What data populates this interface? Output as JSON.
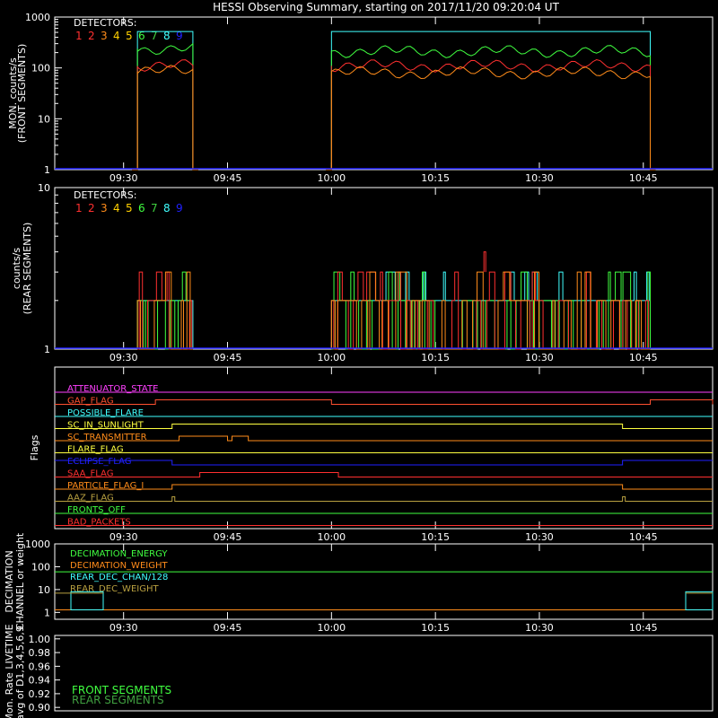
{
  "title": "HESSI Observing Summary, starting on 2017/11/20 09:20:04 UT",
  "colors": {
    "background": "#000000",
    "axes": "#ffffff",
    "det1": "#ff3030",
    "det2": "#ff3030",
    "det3": "#ff8c1a",
    "det4": "#ffd000",
    "det5": "#ffd000",
    "det6": "#40ff40",
    "det7": "#40d040",
    "det8": "#40ffff",
    "det9": "#2020ff"
  },
  "time_ticks": [
    "09:30",
    "09:45",
    "10:00",
    "10:15",
    "10:30",
    "10:45"
  ],
  "panel1": {
    "ylabel": "MON. counts/s",
    "ylabel2": "(FRONT SEGMENTS)",
    "legend_title": "DETECTORS:",
    "yticks": [
      "1",
      "10",
      "100",
      "1000"
    ],
    "detector_numbers": [
      "1",
      "2",
      "3",
      "4",
      "5",
      "6",
      "7",
      "8",
      "9"
    ]
  },
  "panel2": {
    "ylabel": "counts/s",
    "ylabel2": "(REAR SEGMENTS)",
    "legend_title": "DETECTORS:",
    "yticks": [
      "1",
      "10"
    ],
    "detector_numbers": [
      "1",
      "2",
      "3",
      "4",
      "5",
      "6",
      "7",
      "8",
      "9"
    ]
  },
  "panel3": {
    "ylabel": "Flags",
    "flags": [
      {
        "label": "ATTENUATOR_STATE",
        "color": "#ff40ff"
      },
      {
        "label": "GAP_FLAG",
        "color": "#ff5030"
      },
      {
        "label": "POSSIBLE_FLARE",
        "color": "#40ffff"
      },
      {
        "label": "SC_IN_SUNLIGHT",
        "color": "#ffff40"
      },
      {
        "label": "SC_TRANSMITTER",
        "color": "#ff8c1a"
      },
      {
        "label": "FLARE_FLAG",
        "color": "#ffff40"
      },
      {
        "label": "ECLIPSE_FLAG",
        "color": "#2020ff"
      },
      {
        "label": "SAA_FLAG",
        "color": "#ff3030"
      },
      {
        "label": "PARTICLE_FLAG_I",
        "color": "#ff8c1a"
      },
      {
        "label": "AAZ_FLAG",
        "color": "#b8a040"
      },
      {
        "label": "FRONTS_OFF",
        "color": "#40ff40"
      },
      {
        "label": "BAD_PACKETS",
        "color": "#ff3030"
      }
    ]
  },
  "panel4": {
    "ylabel": "DECIMATION",
    "ylabel2": "CHANNEL or weight",
    "yticks": [
      "1",
      "10",
      "100",
      "1000"
    ],
    "series": [
      {
        "label": "DECIMATION_ENERGY",
        "color": "#40ff40"
      },
      {
        "label": "DECIMATION_WEIGHT",
        "color": "#ff8c1a"
      },
      {
        "label": "REAR_DEC_CHAN/128",
        "color": "#40ffff"
      },
      {
        "label": "REAR_DEC_WEIGHT",
        "color": "#b8a040"
      }
    ]
  },
  "panel5": {
    "ylabel": "Mon. Rate LIVETIME",
    "ylabel2": "avg of D1,3,4,5,6,9",
    "yticks": [
      "0.90",
      "0.92",
      "0.94",
      "0.96",
      "0.98",
      "1.00"
    ],
    "legend": [
      {
        "label": "FRONT SEGMENTS",
        "color": "#40ff40"
      },
      {
        "label": "REAR SEGMENTS",
        "color": "#40a040"
      }
    ]
  },
  "chart_data": [
    {
      "type": "line",
      "title": "HESSI Observing Summary, starting on 2017/11/20 09:20:04 UT",
      "ylabel": "MON. counts/s (FRONT SEGMENTS)",
      "yscale": "log",
      "ylim": [
        1,
        1000
      ],
      "xlim": [
        "09:20:04",
        "10:55"
      ],
      "grid": false,
      "legend_placement": "top-left",
      "segments": [
        [
          "09:32",
          "09:40"
        ],
        [
          "10:00",
          "10:46"
        ]
      ],
      "series": [
        {
          "name": "8",
          "values": [
            520,
            520
          ]
        },
        {
          "name": "6",
          "values": [
            240,
            210
          ]
        },
        {
          "name": "1",
          "values": [
            110,
            110
          ]
        },
        {
          "name": "3",
          "values": [
            85,
            80
          ]
        }
      ]
    },
    {
      "type": "line",
      "ylabel": "counts/s (REAR SEGMENTS)",
      "yscale": "log",
      "ylim": [
        1,
        10
      ],
      "xlim": [
        "09:20:04",
        "10:55"
      ],
      "grid": false,
      "levels": [
        1,
        2,
        3,
        4
      ],
      "segments": [
        [
          "09:32",
          "09:40"
        ],
        [
          "10:00",
          "10:46"
        ]
      ]
    },
    {
      "type": "line",
      "ylabel": "Flags",
      "xlim": [
        "09:20:04",
        "10:55"
      ]
    },
    {
      "type": "line",
      "ylabel": "DECIMATION CHANNEL or weight",
      "yscale": "log",
      "ylim": [
        1,
        1000
      ],
      "xlim": [
        "09:20:04",
        "10:55"
      ],
      "series": [
        {
          "name": "DECIMATION_ENERGY",
          "values": [
            60,
            60
          ]
        },
        {
          "name": "DECIMATION_WEIGHT",
          "values": [
            1,
            1
          ]
        },
        {
          "name": "REAR_DEC_CHAN/128",
          "values": [
            8,
            8
          ]
        },
        {
          "name": "REAR_DEC_WEIGHT",
          "values": [
            8,
            8
          ]
        }
      ]
    },
    {
      "type": "line",
      "ylabel": "Mon. Rate LIVETIME avg of D1,3,4,5,6,9",
      "ylim": [
        0.9,
        1.0
      ],
      "xlim": [
        "09:20:04",
        "10:55"
      ],
      "legend_placement": "bottom-left"
    }
  ]
}
